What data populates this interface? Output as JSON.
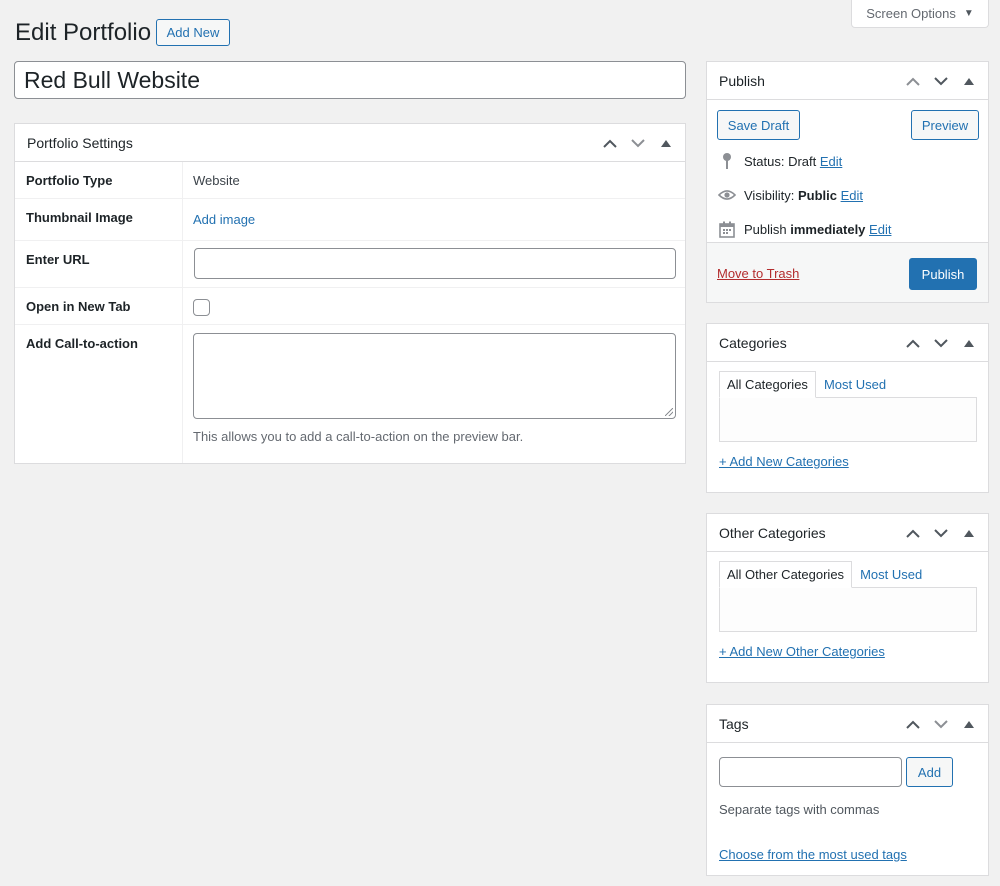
{
  "header": {
    "title": "Edit Portfolio",
    "add_new_label": "Add New",
    "screen_options_label": "Screen Options"
  },
  "post_title": "Red Bull Website",
  "portfolio_settings": {
    "title": "Portfolio Settings",
    "rows": [
      {
        "label": "Portfolio Type",
        "value": "Website"
      },
      {
        "label": "Thumbnail Image",
        "link": "Add image"
      },
      {
        "label": "Enter URL",
        "value": ""
      },
      {
        "label": "Open in New Tab",
        "checked": false
      },
      {
        "label": "Add Call-to-action",
        "help": "This allows you to add a call-to-action on the preview bar."
      }
    ]
  },
  "publish": {
    "title": "Publish",
    "save_draft_label": "Save Draft",
    "preview_label": "Preview",
    "status_label": "Status:",
    "status_value": "Draft",
    "visibility_label": "Visibility:",
    "visibility_value": "Public",
    "publish_label": "Publish",
    "publish_value": "immediately",
    "edit_label": "Edit",
    "trash_label": "Move to Trash",
    "publish_button_label": "Publish"
  },
  "categories": {
    "title": "Categories",
    "tab_all": "All Categories",
    "tab_most_used": "Most Used",
    "add_link": "+ Add New Categories"
  },
  "other_categories": {
    "title": "Other Categories",
    "tab_all": "All Other Categories",
    "tab_most_used": "Most Used",
    "add_link": "+ Add New Other Categories"
  },
  "tags": {
    "title": "Tags",
    "input_value": "",
    "add_label": "Add",
    "help": "Separate tags with commas",
    "choose_link": "Choose from the most used tags"
  },
  "icons": {
    "move_up": "chevron-up-icon",
    "move_down": "chevron-down-icon",
    "toggle": "triangle-up-icon",
    "status": "pin-icon",
    "visibility": "eye-icon",
    "schedule": "calendar-icon"
  },
  "colors": {
    "accent": "#2271b1",
    "trash": "#b32d2e",
    "background": "#f1f1f1"
  }
}
